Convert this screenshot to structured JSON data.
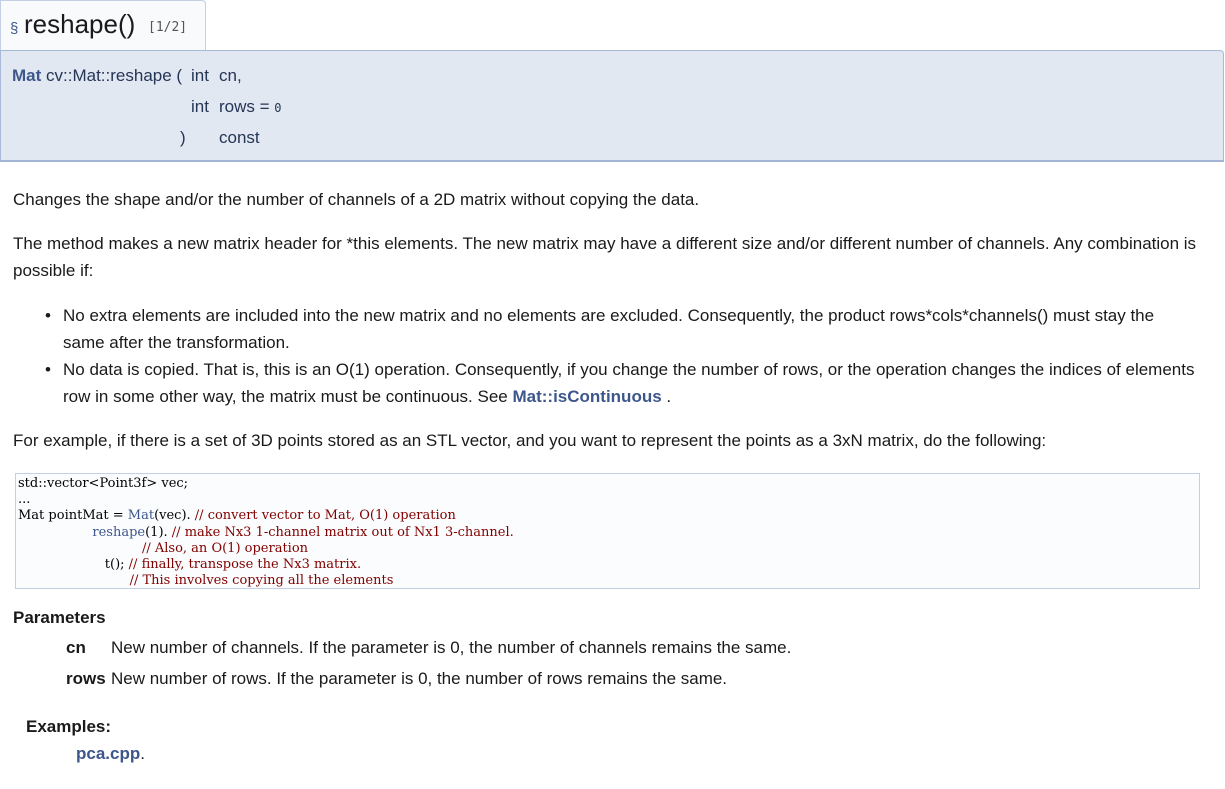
{
  "title": {
    "section_mark": "§",
    "name": "reshape()",
    "overload": "[1/2]"
  },
  "proto": {
    "ret_type": "Mat",
    "func": "cv::Mat::reshape (",
    "p1_type": "int",
    "p1_name": "cn,",
    "p2_type": "int",
    "p2_name": "rows =",
    "p2_default": "0",
    "close": ")",
    "qualifier": "const"
  },
  "brief": "Changes the shape and/or the number of channels of a 2D matrix without copying the data.",
  "description": "The method makes a new matrix header for *this elements. The new matrix may have a different size and/or different number of channels. Any combination is possible if:",
  "bullets": [
    {
      "text": "No extra elements are included into the new matrix and no elements are excluded. Consequently, the product rows*cols*channels() must stay the same after the transformation."
    },
    {
      "text": "No data is copied. That is, this is an O(1) operation. Consequently, if you change the number of rows, or the operation changes the indices of elements row in some other way, the matrix must be continuous. See",
      "link": "Mat::isContinuous",
      "after": " ."
    }
  ],
  "example_intro": "For example, if there is a set of 3D points stored as an STL vector, and you want to represent the points as a 3xN matrix, do the following:",
  "code": {
    "l1": "std::vector<Point3f> vec;",
    "l2": "...",
    "l3_a": "Mat pointMat = ",
    "l3_fn": "Mat",
    "l3_b": "(vec). ",
    "l3_c": "// convert vector to Mat, O(1) operation",
    "l4_pad": "                  ",
    "l4_fn": "reshape",
    "l4_b": "(1). ",
    "l4_c": "// make Nx3 1-channel matrix out of Nx1 3-channel.",
    "l5_pad": "                              ",
    "l5_c": "// Also, an O(1) operation",
    "l6_pad": "                     ",
    "l6_b": "t(); ",
    "l6_c": "// finally, transpose the Nx3 matrix.",
    "l7_pad": "                           ",
    "l7_c": "// This involves copying all the elements"
  },
  "parameters": {
    "title": "Parameters",
    "items": [
      {
        "name": "cn",
        "desc": "New number of channels. If the parameter is 0, the number of channels remains the same."
      },
      {
        "name": "rows",
        "desc": "New number of rows. If the parameter is 0, the number of rows remains the same."
      }
    ]
  },
  "examples": {
    "title": "Examples:",
    "link": "pca.cpp",
    "suffix": "."
  }
}
